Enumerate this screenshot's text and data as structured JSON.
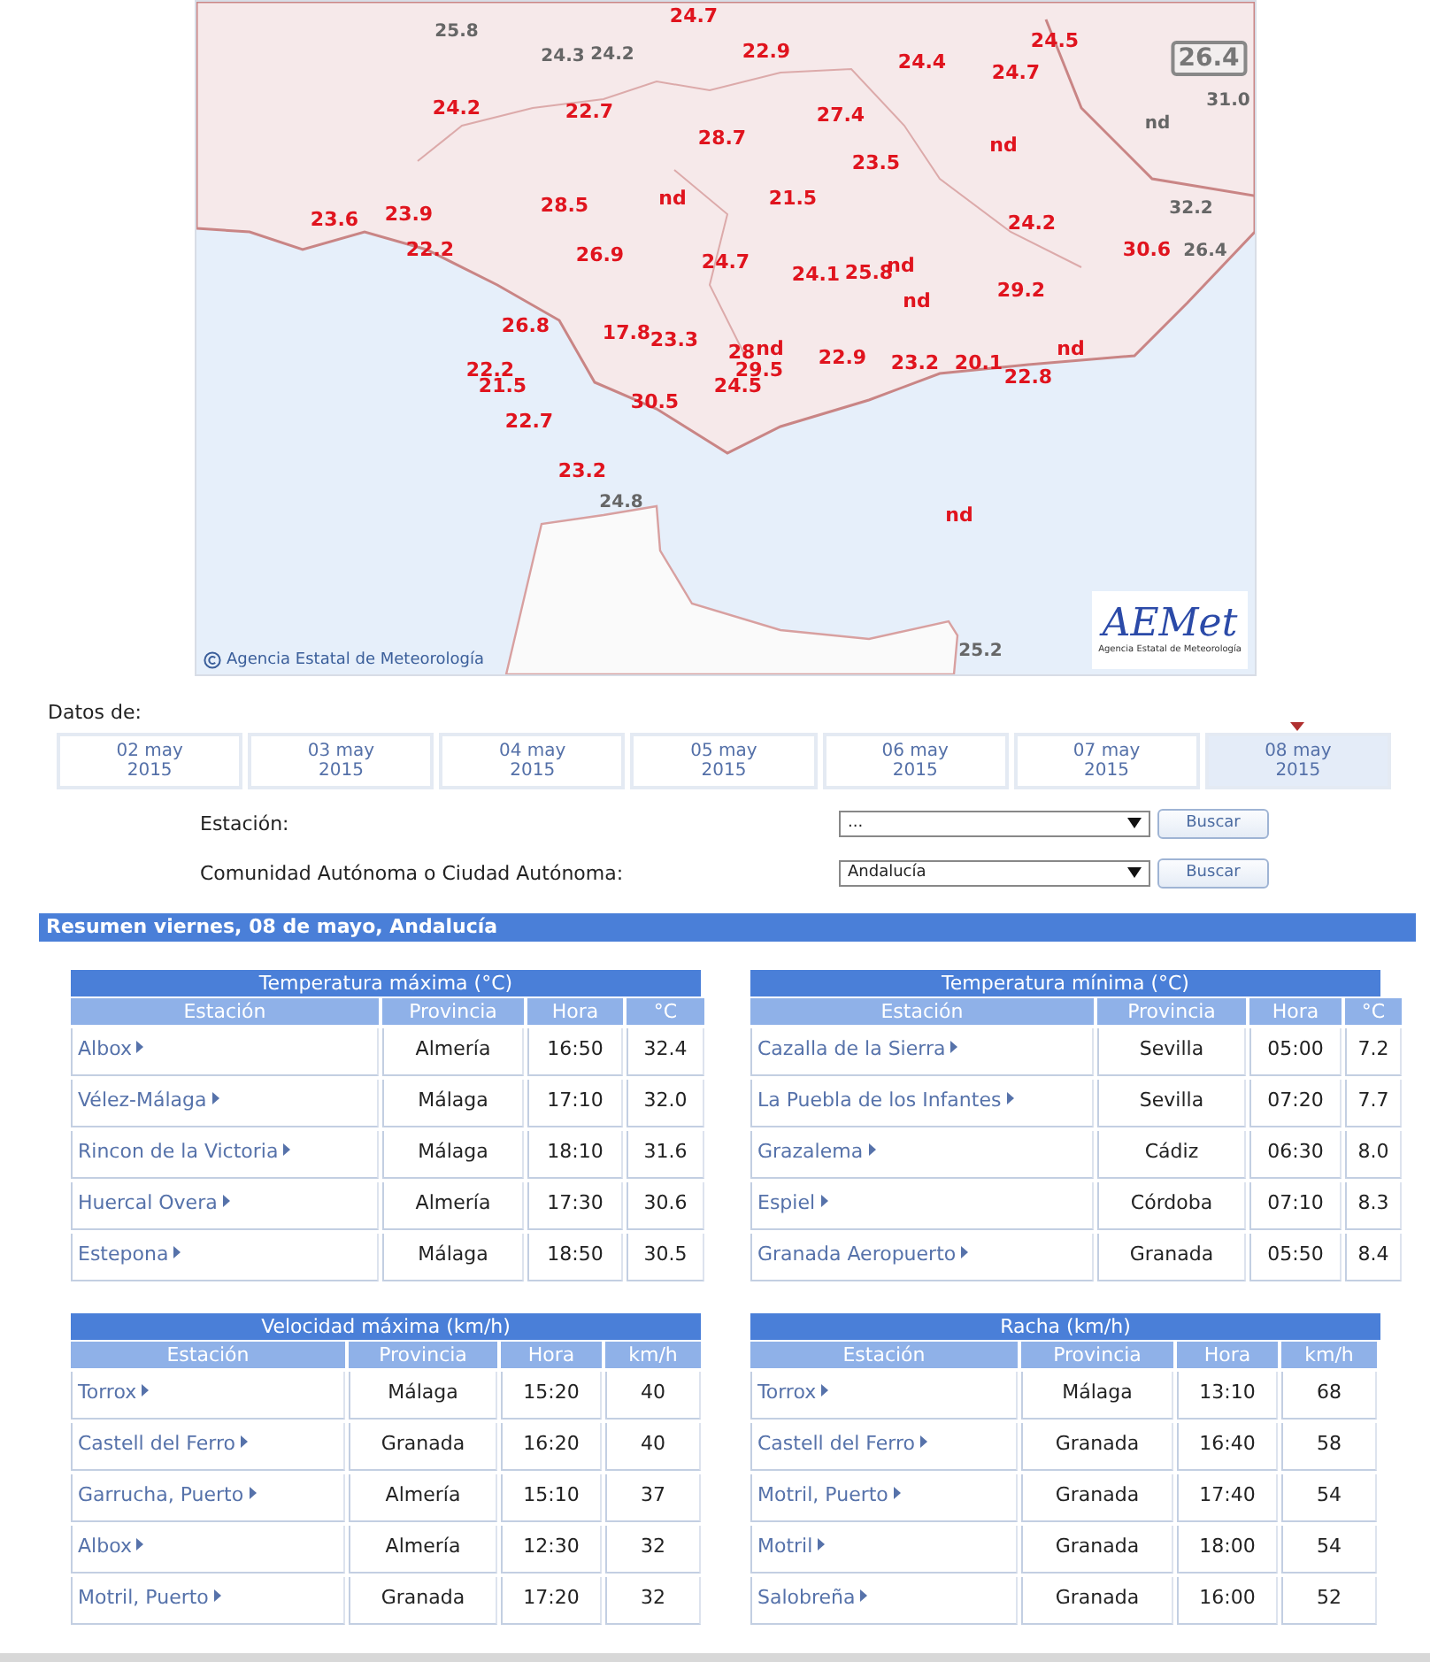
{
  "map": {
    "labels": [
      {
        "text": "24.7",
        "kind": "inside"
      },
      {
        "text": "22.9",
        "kind": "inside"
      },
      {
        "text": "24.5",
        "kind": "inside"
      },
      {
        "text": "24.4",
        "kind": "inside"
      },
      {
        "text": "24.7",
        "kind": "inside"
      },
      {
        "text": "24.2",
        "kind": "inside"
      },
      {
        "text": "22.7",
        "kind": "inside"
      },
      {
        "text": "27.4",
        "kind": "inside"
      },
      {
        "text": "28.7",
        "kind": "inside"
      },
      {
        "text": "23.5",
        "kind": "inside"
      },
      {
        "text": "nd",
        "kind": "inside"
      },
      {
        "text": "21.5",
        "kind": "inside"
      },
      {
        "text": "28.5",
        "kind": "inside"
      },
      {
        "text": "nd",
        "kind": "inside"
      },
      {
        "text": "23.6",
        "kind": "inside"
      },
      {
        "text": "23.9",
        "kind": "inside"
      },
      {
        "text": "24.2",
        "kind": "inside"
      },
      {
        "text": "22.2",
        "kind": "inside"
      },
      {
        "text": "26.9",
        "kind": "inside"
      },
      {
        "text": "24.7",
        "kind": "inside"
      },
      {
        "text": "24.1",
        "kind": "inside"
      },
      {
        "text": "25.8",
        "kind": "inside"
      },
      {
        "text": "nd",
        "kind": "inside"
      },
      {
        "text": "30.6",
        "kind": "inside"
      },
      {
        "text": "nd",
        "kind": "inside"
      },
      {
        "text": "29.2",
        "kind": "inside"
      },
      {
        "text": "26.8",
        "kind": "inside"
      },
      {
        "text": "17.8",
        "kind": "inside"
      },
      {
        "text": "23.3",
        "kind": "inside"
      },
      {
        "text": "28",
        "kind": "inside"
      },
      {
        "text": "nd",
        "kind": "inside"
      },
      {
        "text": "29.5",
        "kind": "inside"
      },
      {
        "text": "22.9",
        "kind": "inside"
      },
      {
        "text": "23.2",
        "kind": "inside"
      },
      {
        "text": "20.1",
        "kind": "inside"
      },
      {
        "text": "nd",
        "kind": "inside"
      },
      {
        "text": "22.2",
        "kind": "inside"
      },
      {
        "text": "21.5",
        "kind": "inside"
      },
      {
        "text": "22.8",
        "kind": "inside"
      },
      {
        "text": "24.5",
        "kind": "inside"
      },
      {
        "text": "30.5",
        "kind": "inside"
      },
      {
        "text": "22.7",
        "kind": "inside"
      },
      {
        "text": "23.2",
        "kind": "inside"
      },
      {
        "text": "nd",
        "kind": "inside"
      },
      {
        "text": "25.8",
        "kind": "outside"
      },
      {
        "text": "24.3",
        "kind": "outside"
      },
      {
        "text": "24.2",
        "kind": "outside"
      },
      {
        "text": "26.4",
        "kind": "boxed"
      },
      {
        "text": "31.0",
        "kind": "outside"
      },
      {
        "text": "nd",
        "kind": "outside"
      },
      {
        "text": "32.2",
        "kind": "outside"
      },
      {
        "text": "26.4",
        "kind": "outside"
      },
      {
        "text": "24.8",
        "kind": "outside"
      },
      {
        "text": "25.2",
        "kind": "outside"
      }
    ],
    "credit": "Agencia Estatal de Meteorología",
    "logo_text": "AEMet",
    "logo_caption": "Agencia Estatal de Meteorología"
  },
  "dates_label": "Datos de:",
  "date_tabs": [
    {
      "day": "02 may",
      "year": "2015",
      "selected": false
    },
    {
      "day": "03 may",
      "year": "2015",
      "selected": false
    },
    {
      "day": "04 may",
      "year": "2015",
      "selected": false
    },
    {
      "day": "05 may",
      "year": "2015",
      "selected": false
    },
    {
      "day": "06 may",
      "year": "2015",
      "selected": false
    },
    {
      "day": "07 may",
      "year": "2015",
      "selected": false
    },
    {
      "day": "08 may",
      "year": "2015",
      "selected": true
    }
  ],
  "filters": [
    {
      "label": "Estación:",
      "value": "...",
      "button": "Buscar"
    },
    {
      "label": "Comunidad Autónoma o Ciudad Autónoma:",
      "value": "Andalucía",
      "button": "Buscar"
    }
  ],
  "summary_title": "Resumen viernes, 08 de mayo, Andalucía",
  "tables": [
    {
      "title": "Temperatura máxima (°C)",
      "columns": [
        "Estación",
        "Provincia",
        "Hora",
        "°C"
      ],
      "rows": [
        {
          "station": "Albox",
          "province": "Almería",
          "time": "16:50",
          "value": "32.4"
        },
        {
          "station": "Vélez-Málaga",
          "province": "Málaga",
          "time": "17:10",
          "value": "32.0"
        },
        {
          "station": "Rincon de la Victoria",
          "province": "Málaga",
          "time": "18:10",
          "value": "31.6"
        },
        {
          "station": "Huercal Overa",
          "province": "Almería",
          "time": "17:30",
          "value": "30.6"
        },
        {
          "station": "Estepona",
          "province": "Málaga",
          "time": "18:50",
          "value": "30.5"
        }
      ]
    },
    {
      "title": "Temperatura mínima (°C)",
      "columns": [
        "Estación",
        "Provincia",
        "Hora",
        "°C"
      ],
      "rows": [
        {
          "station": "Cazalla de la Sierra",
          "province": "Sevilla",
          "time": "05:00",
          "value": "7.2"
        },
        {
          "station": "La Puebla de los Infantes",
          "province": "Sevilla",
          "time": "07:20",
          "value": "7.7"
        },
        {
          "station": "Grazalema",
          "province": "Cádiz",
          "time": "06:30",
          "value": "8.0"
        },
        {
          "station": "Espiel",
          "province": "Córdoba",
          "time": "07:10",
          "value": "8.3"
        },
        {
          "station": "Granada Aeropuerto",
          "province": "Granada",
          "time": "05:50",
          "value": "8.4"
        }
      ]
    },
    {
      "title": "Velocidad máxima (km/h)",
      "columns": [
        "Estación",
        "Provincia",
        "Hora",
        "km/h"
      ],
      "rows": [
        {
          "station": "Torrox",
          "province": "Málaga",
          "time": "15:20",
          "value": "40"
        },
        {
          "station": "Castell del Ferro",
          "province": "Granada",
          "time": "16:20",
          "value": "40"
        },
        {
          "station": "Garrucha, Puerto",
          "province": "Almería",
          "time": "15:10",
          "value": "37"
        },
        {
          "station": "Albox",
          "province": "Almería",
          "time": "12:30",
          "value": "32"
        },
        {
          "station": "Motril, Puerto",
          "province": "Granada",
          "time": "17:20",
          "value": "32"
        }
      ]
    },
    {
      "title": "Racha (km/h)",
      "columns": [
        "Estación",
        "Provincia",
        "Hora",
        "km/h"
      ],
      "rows": [
        {
          "station": "Torrox",
          "province": "Málaga",
          "time": "13:10",
          "value": "68"
        },
        {
          "station": "Castell del Ferro",
          "province": "Granada",
          "time": "16:40",
          "value": "58"
        },
        {
          "station": "Motril, Puerto",
          "province": "Granada",
          "time": "17:40",
          "value": "54"
        },
        {
          "station": "Motril",
          "province": "Granada",
          "time": "18:00",
          "value": "54"
        },
        {
          "station": "Salobreña",
          "province": "Granada",
          "time": "16:00",
          "value": "52"
        }
      ]
    }
  ]
}
